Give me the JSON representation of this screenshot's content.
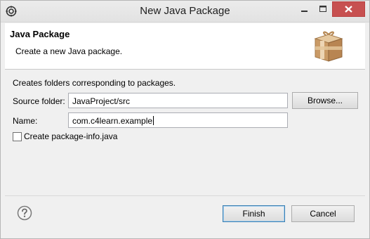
{
  "window": {
    "title": "New Java Package",
    "icons": {
      "app": "eclipse-gear-icon",
      "minimize": "minimize-icon",
      "maximize": "maximize-icon",
      "close": "close-icon"
    }
  },
  "banner": {
    "title": "Java Package",
    "description": "Create a new Java package.",
    "icon": "package-box-icon"
  },
  "form": {
    "intro": "Creates folders corresponding to packages.",
    "source_folder_label": "Source folder:",
    "source_folder_value": "JavaProject/src",
    "browse_label": "Browse...",
    "name_label": "Name:",
    "name_value": "com.c4learn.example",
    "package_info_label": "Create package-info.java",
    "package_info_checked": false
  },
  "footer": {
    "help_icon": "help-icon",
    "finish_label": "Finish",
    "cancel_label": "Cancel"
  }
}
